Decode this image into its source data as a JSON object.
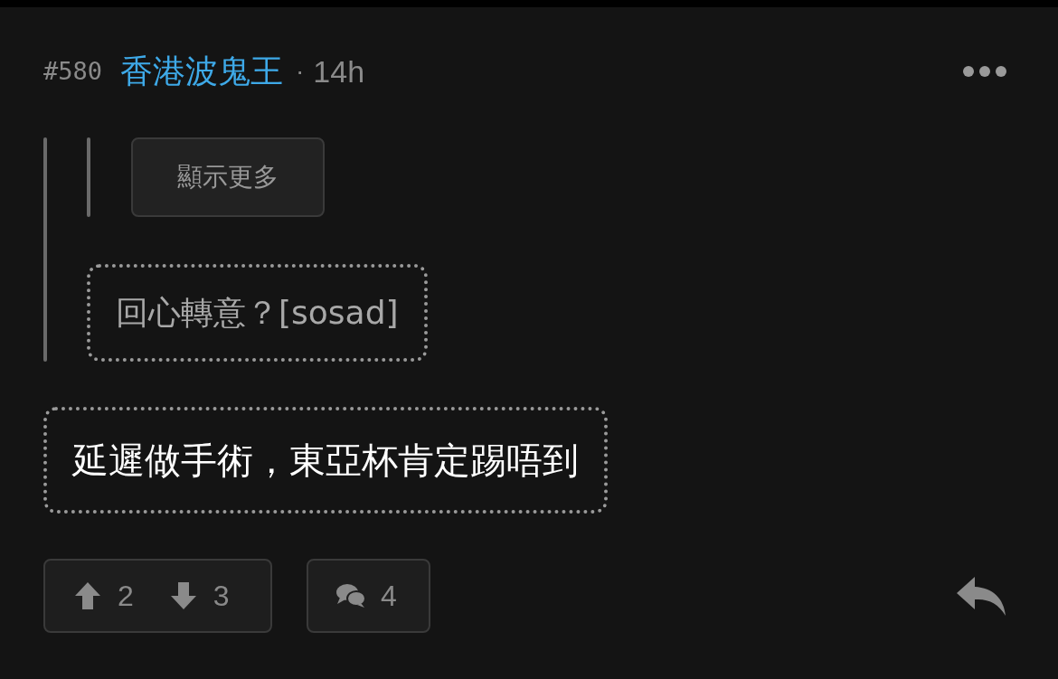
{
  "post": {
    "number": "#580",
    "author": "香港波鬼王",
    "separator": "·",
    "time": "14h"
  },
  "quote": {
    "nested": {
      "show_more": "顯示更多"
    },
    "text": "回心轉意？[sosad]"
  },
  "body": "延遲做手術，東亞杯肯定踢唔到",
  "actions": {
    "upvotes": "2",
    "downvotes": "3",
    "comments": "4"
  }
}
